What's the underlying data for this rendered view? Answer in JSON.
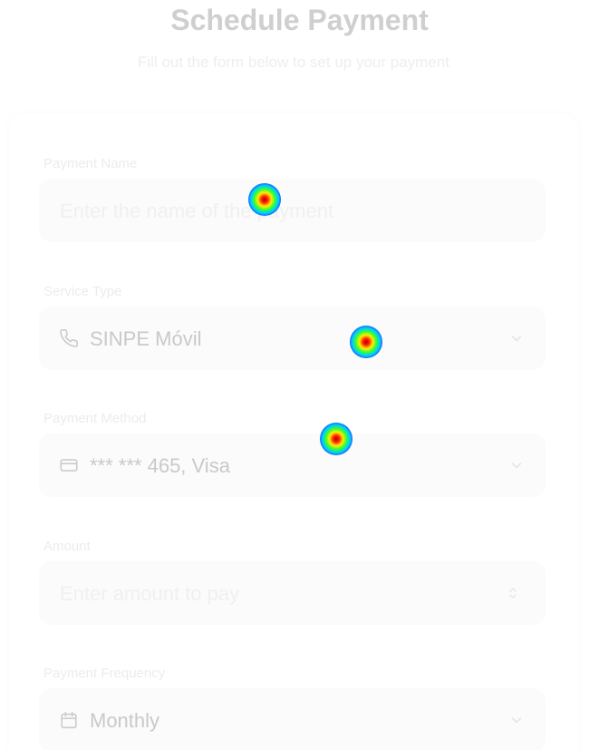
{
  "header": {
    "title": "Schedule Payment",
    "subtitle": "Fill out the form below to set up your payment"
  },
  "form": {
    "payment_name": {
      "label": "Payment Name",
      "placeholder": "Enter the name of the payment"
    },
    "service_type": {
      "label": "Service Type",
      "value": "SINPE Móvil",
      "icon": "phone-icon"
    },
    "payment_method": {
      "label": "Payment Method",
      "value": "*** *** 465, Visa",
      "icon": "credit-card-icon"
    },
    "amount": {
      "label": "Amount",
      "placeholder": "Enter amount to pay"
    },
    "payment_frequency": {
      "label": "Payment Frequency",
      "value": "Monthly",
      "icon": "calendar-icon"
    }
  },
  "colors": {
    "title": "#cfcfcf",
    "field_background": "#fbfbfb",
    "value_text": "#c9c9c9",
    "placeholder_text": "#f0f0f0"
  }
}
